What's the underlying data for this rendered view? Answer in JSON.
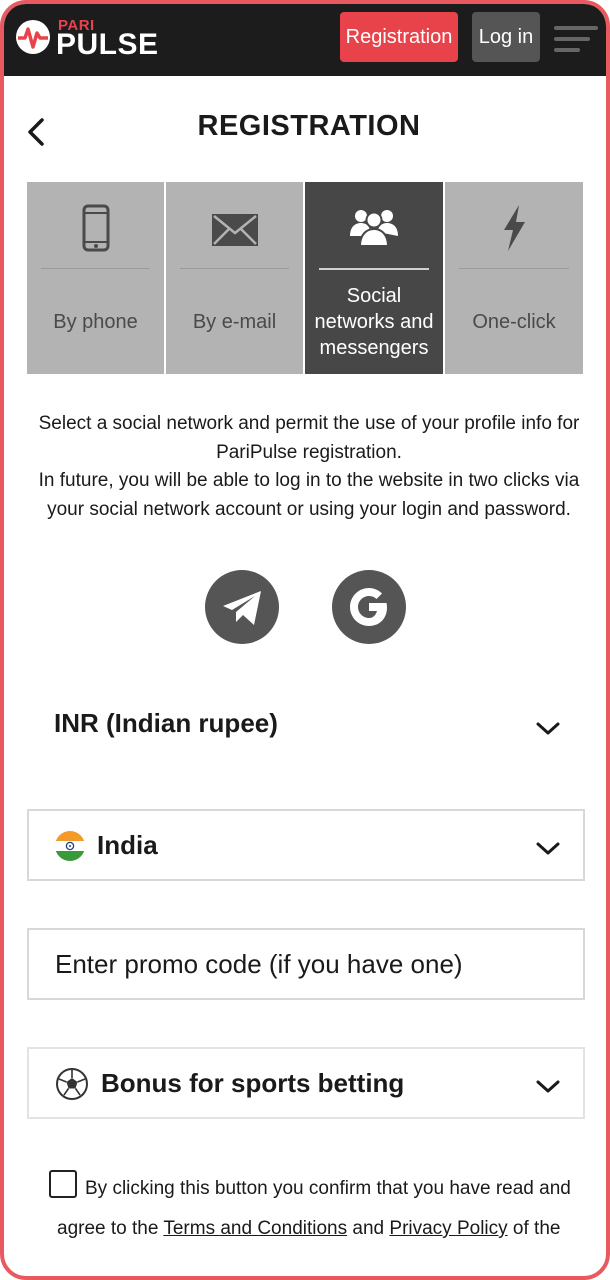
{
  "header": {
    "logo_top": "PARI",
    "logo_bottom": "PULSE",
    "registration_label": "Registration",
    "login_label": "Log in",
    "brand_color": "#e8434b"
  },
  "page": {
    "title": "REGISTRATION"
  },
  "tabs": [
    {
      "label": "By phone",
      "icon": "phone-icon",
      "active": false
    },
    {
      "label": "By e-mail",
      "icon": "envelope-icon",
      "active": false
    },
    {
      "label": "Social networks and messengers",
      "icon": "users-icon",
      "active": true
    },
    {
      "label": "One-click",
      "icon": "lightning-icon",
      "active": false
    }
  ],
  "info": {
    "line1": "Select a social network and permit the use of your profile info for",
    "line2": "PariPulse registration.",
    "line3": "In future, you will be able to log in to the website in two clicks via",
    "line4": "your social network account or using your login and password."
  },
  "social": [
    {
      "name": "Telegram",
      "icon": "telegram-icon"
    },
    {
      "name": "Google",
      "icon": "google-icon"
    }
  ],
  "currency": {
    "value": "INR (Indian rupee)"
  },
  "country": {
    "value": "India"
  },
  "promo": {
    "placeholder": "Enter promo code (if you have one)"
  },
  "bonus": {
    "value": "Bonus for sports betting"
  },
  "terms": {
    "text1": "By clicking this button you confirm that you have read and",
    "text2a": "agree to the",
    "terms_link": "Terms and Conditions",
    "and": "and",
    "privacy_link": "Privacy Policy",
    "text2b": "of the"
  }
}
